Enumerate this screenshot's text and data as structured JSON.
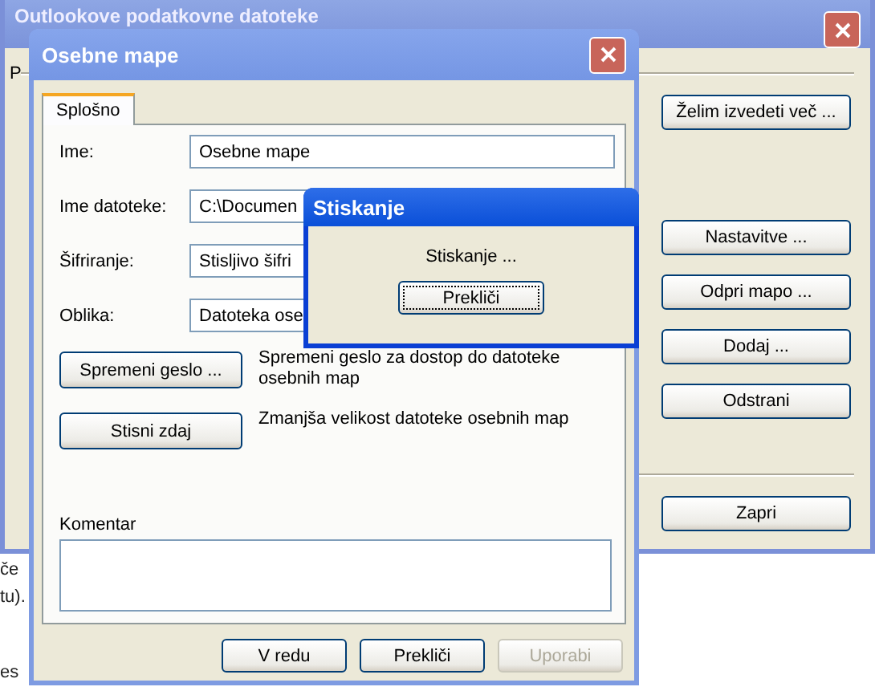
{
  "document_text": [
    "če",
    "tu).",
    "es"
  ],
  "back_window": {
    "title": "Outlookove podatkovne datoteke",
    "label": "P",
    "top_button": "Želim izvedeti več ...",
    "side_buttons": [
      "Nastavitve ...",
      "Odpri mapo ...",
      "Dodaj ...",
      "Odstrani"
    ],
    "footer_button": "Zapri"
  },
  "front_window": {
    "title": "Osebne mape",
    "tabs": [
      {
        "label": "Splošno",
        "selected": true
      }
    ],
    "fields": [
      {
        "label": "Ime:",
        "value": "Osebne mape"
      },
      {
        "label": "Ime datoteke:",
        "value": "C:\\Documen"
      },
      {
        "label": "Šifriranje:",
        "value": "Stisljivo šifri"
      },
      {
        "label": "Oblika:",
        "value": "Datoteka ose"
      }
    ],
    "actions": [
      {
        "button": "Spremeni geslo ...",
        "description": "Spremeni geslo za dostop do datoteke osebnih map"
      },
      {
        "button": "Stisni zdaj",
        "description": "Zmanjša velikost datoteke osebnih map"
      }
    ],
    "comment_label": "Komentar",
    "buttons": [
      {
        "label": "V redu",
        "disabled": false
      },
      {
        "label": "Prekliči",
        "disabled": false
      },
      {
        "label": "Uporabi",
        "disabled": true
      }
    ]
  },
  "dialog": {
    "title": "Stiskanje",
    "message": "Stiskanje ...",
    "button": {
      "label": "Prekliči",
      "focused": true
    }
  }
}
